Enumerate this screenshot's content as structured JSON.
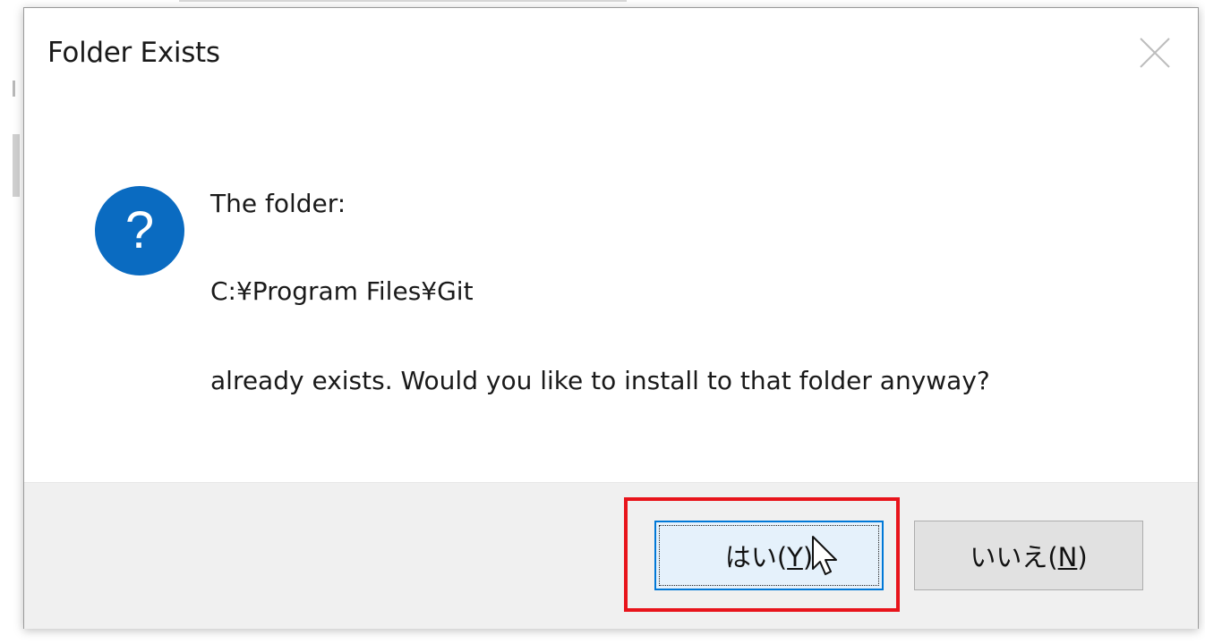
{
  "dialog": {
    "title": "Folder Exists",
    "message": {
      "line1": "The folder:",
      "path": "C:¥Program Files¥Git",
      "question": "already exists. Would you like to install to that folder anyway?"
    },
    "icon": "question-icon",
    "buttons": {
      "yes": {
        "label": "はい(",
        "mnemonic": "Y",
        "suffix": ")"
      },
      "no": {
        "label": "いいえ(",
        "mnemonic": "N",
        "suffix": ")"
      }
    }
  },
  "colors": {
    "accent": "#0078d7",
    "question_icon": "#0a6bc1",
    "highlight": "#e8141b",
    "footer_bg": "#f0f0f0"
  }
}
